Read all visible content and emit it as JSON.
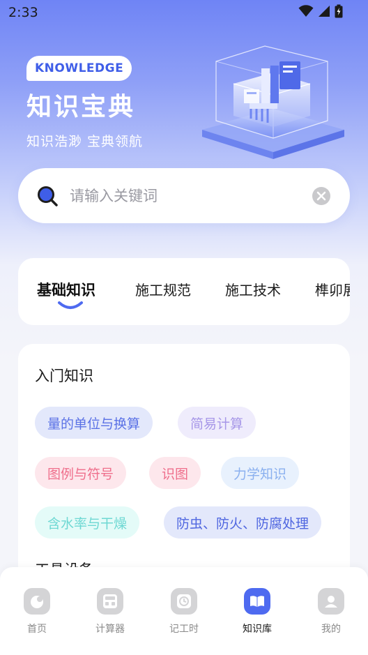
{
  "status_bar": {
    "time": "2:33"
  },
  "hero": {
    "badge": "KNOWLEDGE",
    "title": "知识宝典",
    "subtitle": "知识浩渺  宝典领航"
  },
  "search": {
    "placeholder": "请输入关键词",
    "value": ""
  },
  "tabs": [
    {
      "label": "基础知识",
      "active": true
    },
    {
      "label": "施工规范",
      "active": false
    },
    {
      "label": "施工技术",
      "active": false
    },
    {
      "label": "榫卯展",
      "active": false
    }
  ],
  "sections": [
    {
      "title": "入门知识",
      "chips": [
        {
          "label": "量的单位与换算",
          "color": "#5b72e6",
          "bg": "#e3e8fb"
        },
        {
          "label": "简易计算",
          "color": "#a797e8",
          "bg": "#efecfc"
        },
        {
          "label": "图例与符号",
          "color": "#ef6f8c",
          "bg": "#fde7ec"
        },
        {
          "label": "识图",
          "color": "#ef6f8c",
          "bg": "#fde7ec"
        },
        {
          "label": "力学知识",
          "color": "#8ab0ef",
          "bg": "#e8f1fd"
        },
        {
          "label": "含水率与干燥",
          "color": "#6ed8d3",
          "bg": "#e4fbf8"
        },
        {
          "label": "防虫、防火、防腐处理",
          "color": "#4f66e0",
          "bg": "#e3e8fb"
        }
      ]
    },
    {
      "title": "工具设备"
    }
  ],
  "bottom_nav": [
    {
      "label": "首页",
      "icon": "home-face-icon",
      "active": false
    },
    {
      "label": "计算器",
      "icon": "calculator-icon",
      "active": false
    },
    {
      "label": "记工时",
      "icon": "clock-icon",
      "active": false
    },
    {
      "label": "知识库",
      "icon": "book-icon",
      "active": true
    },
    {
      "label": "我的",
      "icon": "profile-icon",
      "active": false
    }
  ],
  "colors": {
    "accent": "#3f5ee8",
    "nav_active_bg": "#4e6af0",
    "nav_inactive_bg": "#d4d4d6"
  }
}
